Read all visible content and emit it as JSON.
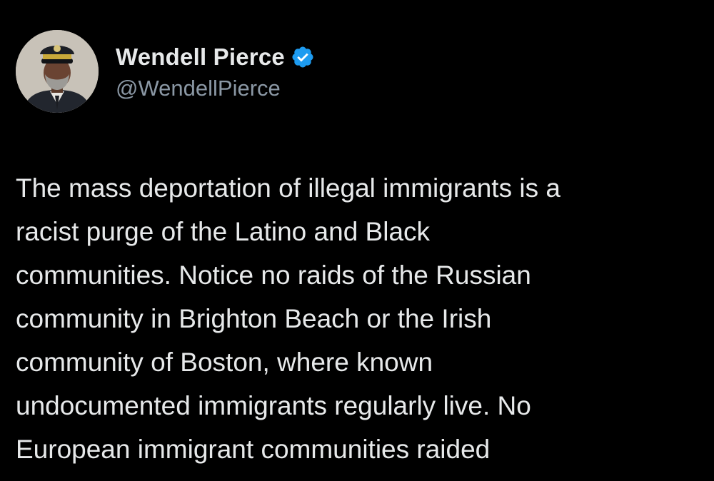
{
  "author": {
    "display_name": "Wendell Pierce",
    "handle": "@WendellPierce",
    "verified": true,
    "verified_color": "#1d9bf0"
  },
  "tweet": {
    "lines": [
      "The mass deportation of illegal immigrants is a",
      "racist purge of the Latino and Black",
      "communities. Notice no raids of the Russian",
      "community in Brighton Beach or the Irish",
      "community of Boston, where known",
      "undocumented immigrants regularly live. No",
      "European immigrant communities raided"
    ]
  },
  "colors": {
    "background": "#000000",
    "text_primary": "#e7e9ea",
    "text_secondary": "#8b98a5"
  },
  "icons": {
    "verified": "verified-badge-icon",
    "avatar": "profile-photo"
  }
}
